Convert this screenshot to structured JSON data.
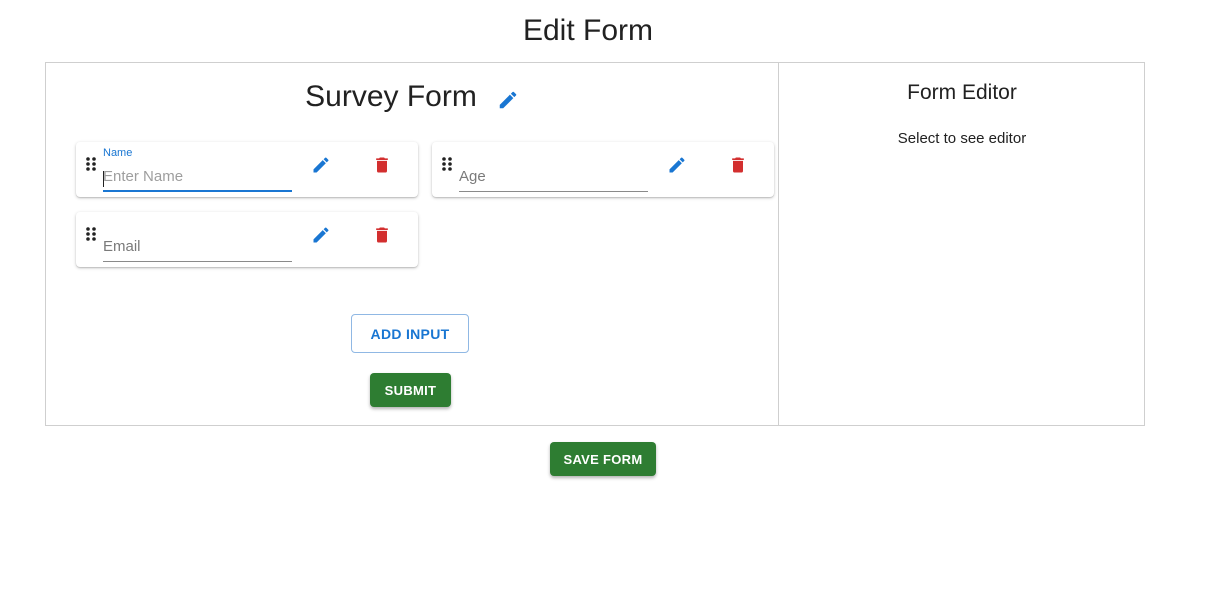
{
  "page": {
    "title": "Edit Form",
    "save_label": "SAVE FORM"
  },
  "form": {
    "title": "Survey Form",
    "fields": [
      {
        "label": "Name",
        "placeholder": "Enter Name",
        "value": "",
        "focused": true
      },
      {
        "label": "",
        "placeholder": "Age",
        "value": "",
        "focused": false
      },
      {
        "label": "",
        "placeholder": "Email",
        "value": "",
        "focused": false
      }
    ],
    "add_input_label": "ADD INPUT",
    "submit_label": "SUBMIT"
  },
  "editor": {
    "title": "Form Editor",
    "hint": "Select to see editor"
  },
  "colors": {
    "primary": "#1976d2",
    "danger": "#d32f2f",
    "success": "#2e7d32",
    "border": "#cfcfcf"
  },
  "icons": {
    "drag": "drag-handle-icon",
    "edit": "pencil-icon",
    "delete": "trash-icon"
  }
}
